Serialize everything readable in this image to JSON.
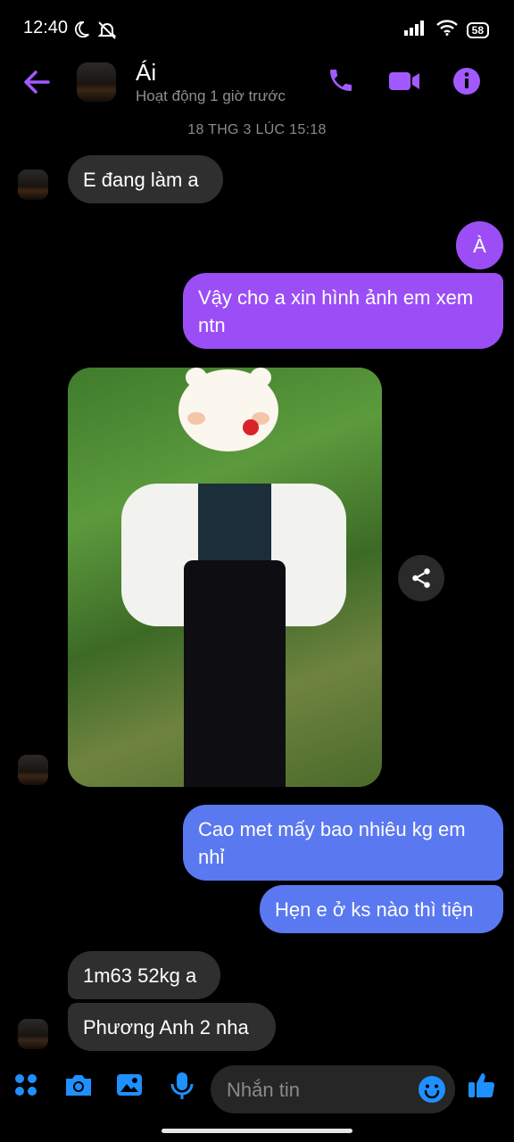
{
  "status_bar": {
    "time": "12:40",
    "battery": "58"
  },
  "header": {
    "contact_name": "Ái",
    "contact_status": "Hoạt động 1 giờ trước"
  },
  "timestamp": "18 THG 3 LÚC 15:18",
  "messages": [
    {
      "text": "E đang làm a"
    },
    {
      "text": "À"
    },
    {
      "text": "Vậy cho a xin hình ảnh em xem ntn"
    },
    {
      "text": "Cao met mấy bao nhiêu kg em nhỉ"
    },
    {
      "text": "Hẹn e ở ks nào thì tiện"
    },
    {
      "text": "1m63 52kg a"
    },
    {
      "text": "Phương Anh 2 nha"
    }
  ],
  "composer": {
    "placeholder": "Nhắn tin"
  },
  "colors": {
    "accent": "#a259ff",
    "outgoing_purple": "#9b4ef5",
    "outgoing_blue": "#5a78f0",
    "incoming": "#2f2f2f"
  }
}
